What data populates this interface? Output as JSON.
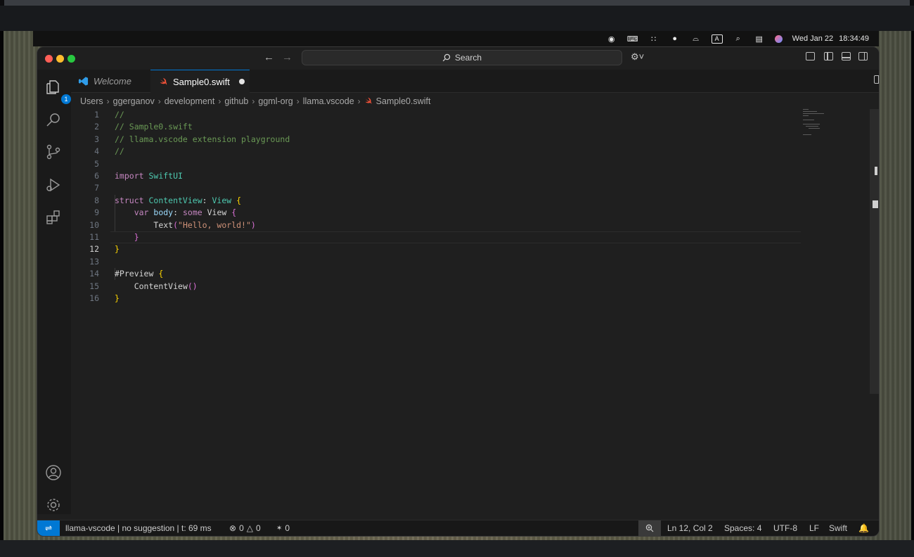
{
  "menubar": {
    "date": "Wed Jan 22",
    "time": "18:34:49",
    "input_source": "A"
  },
  "window": {
    "search_placeholder": "Search",
    "tabs": [
      {
        "label": "Welcome",
        "icon": "vscode-icon"
      },
      {
        "label": "Sample0.swift",
        "icon": "swift-icon",
        "dirty": true
      }
    ]
  },
  "activitybar": {
    "explorer_badge": "1"
  },
  "breadcrumb": [
    "Users",
    "ggerganov",
    "development",
    "github",
    "ggml-org",
    "llama.vscode",
    "Sample0.swift"
  ],
  "editor": {
    "active_line": 12,
    "line_numbers": [
      "1",
      "2",
      "3",
      "4",
      "5",
      "6",
      "7",
      "8",
      "9",
      "10",
      "11",
      "12",
      "13",
      "14",
      "15",
      "16"
    ],
    "lines": [
      [
        {
          "t": "//",
          "c": "comment"
        }
      ],
      [
        {
          "t": "// Sample0.swift",
          "c": "comment"
        }
      ],
      [
        {
          "t": "// llama.vscode extension playground",
          "c": "comment"
        }
      ],
      [
        {
          "t": "//",
          "c": "comment"
        }
      ],
      [],
      [
        {
          "t": "import",
          "c": "kw"
        },
        {
          "t": " SwiftUI",
          "c": "type"
        }
      ],
      [],
      [
        {
          "t": "struct",
          "c": "kw"
        },
        {
          "t": " ContentView",
          "c": "type"
        },
        {
          "t": ": ",
          "c": "punct"
        },
        {
          "t": "View",
          "c": "type"
        },
        {
          "t": " ",
          "c": "punct"
        },
        {
          "t": "{",
          "c": "brace"
        }
      ],
      [
        {
          "t": "    ",
          "c": "punct"
        },
        {
          "t": "var",
          "c": "kw"
        },
        {
          "t": " body",
          "c": "var"
        },
        {
          "t": ": ",
          "c": "punct"
        },
        {
          "t": "some",
          "c": "kw"
        },
        {
          "t": " View ",
          "c": "punct"
        },
        {
          "t": "{",
          "c": "brace2"
        }
      ],
      [
        {
          "t": "        ",
          "c": "punct"
        },
        {
          "t": "Text",
          "c": "punct"
        },
        {
          "t": "(",
          "c": "brace2"
        },
        {
          "t": "\"Hello, world!\"",
          "c": "str"
        },
        {
          "t": ")",
          "c": "brace2"
        }
      ],
      [
        {
          "t": "    ",
          "c": "punct"
        },
        {
          "t": "}",
          "c": "brace2"
        }
      ],
      [
        {
          "t": "}",
          "c": "brace"
        }
      ],
      [],
      [
        {
          "t": "#Preview",
          "c": "punct"
        },
        {
          "t": " ",
          "c": "punct"
        },
        {
          "t": "{",
          "c": "brace"
        }
      ],
      [
        {
          "t": "    ",
          "c": "punct"
        },
        {
          "t": "ContentView",
          "c": "punct"
        },
        {
          "t": "()",
          "c": "brace2"
        }
      ],
      [
        {
          "t": "}",
          "c": "brace"
        }
      ]
    ]
  },
  "statusbar": {
    "llama_status": "llama-vscode | no suggestion | t: 69 ms",
    "errors": "0",
    "warnings": "0",
    "ports": "0",
    "position": "Ln 12, Col 2",
    "spaces": "Spaces: 4",
    "encoding": "UTF-8",
    "eol": "LF",
    "language": "Swift"
  },
  "colors": {
    "accent": "#0078d4",
    "comment": "#6a9955",
    "keyword": "#c586c0",
    "type": "#4ec9b0",
    "string": "#ce9178"
  }
}
